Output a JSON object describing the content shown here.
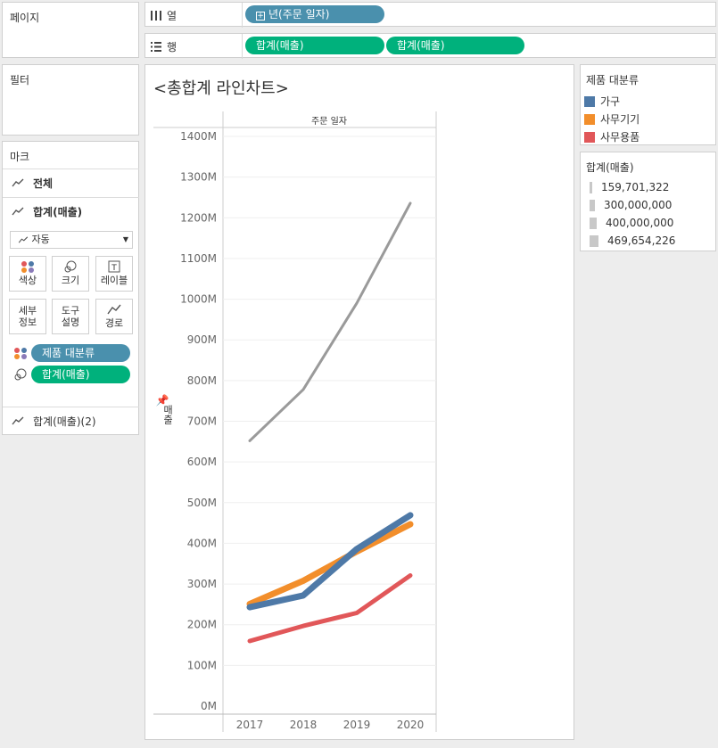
{
  "side": {
    "pages_title": "페이지",
    "filters_title": "필터",
    "marks_title": "마크",
    "marks_all": "전체",
    "marks_sum": "합계(매출)",
    "marks_sum2": "합계(매출)(2)",
    "mark_type": "자동",
    "buttons": {
      "color": "색상",
      "size": "크기",
      "label": "레이블",
      "detail": "세부\n정보",
      "tooltip": "도구\n설명",
      "path": "경로"
    },
    "mark_pill_color": "제품 대분류",
    "mark_pill_size": "합계(매출)"
  },
  "shelves": {
    "columns_label": "열",
    "rows_label": "행",
    "columns_pill": "년(주문 일자)",
    "rows_pill1": "합계(매출)",
    "rows_pill2": "합계(매출)"
  },
  "chart_data": {
    "type": "line",
    "title": "<총합계 라인차트>",
    "header": "주문 일자",
    "ylabel": "매출",
    "categories": [
      "2017",
      "2018",
      "2019",
      "2020"
    ],
    "ylim": [
      0,
      1400
    ],
    "yticks": [
      "0M",
      "100M",
      "200M",
      "300M",
      "400M",
      "500M",
      "600M",
      "700M",
      "800M",
      "900M",
      "1000M",
      "1100M",
      "1200M",
      "1300M",
      "1400M"
    ],
    "grid": true,
    "series": [
      {
        "name": "총합계",
        "color": "#9a9a9a",
        "values": [
          652,
          778,
          990,
          1236
        ],
        "width": 3
      },
      {
        "name": "사무기기",
        "color": "#f28e2b",
        "values": [
          251,
          308,
          380,
          447
        ],
        "width": 7
      },
      {
        "name": "가구",
        "color": "#4e79a7",
        "values": [
          243,
          272,
          386,
          469
        ],
        "width": 7
      },
      {
        "name": "사무용품",
        "color": "#e15759",
        "values": [
          160,
          197,
          229,
          321
        ],
        "width": 5
      }
    ]
  },
  "legend_color": {
    "title": "제품 대분류",
    "items": [
      {
        "label": "가구",
        "color": "#4e79a7"
      },
      {
        "label": "사무기기",
        "color": "#f28e2b"
      },
      {
        "label": "사무용품",
        "color": "#e15759"
      }
    ]
  },
  "legend_size": {
    "title": "합계(매출)",
    "items": [
      {
        "label": "159,701,322",
        "w": 3
      },
      {
        "label": "300,000,000",
        "w": 6
      },
      {
        "label": "400,000,000",
        "w": 8
      },
      {
        "label": "469,654,226",
        "w": 10
      }
    ]
  }
}
